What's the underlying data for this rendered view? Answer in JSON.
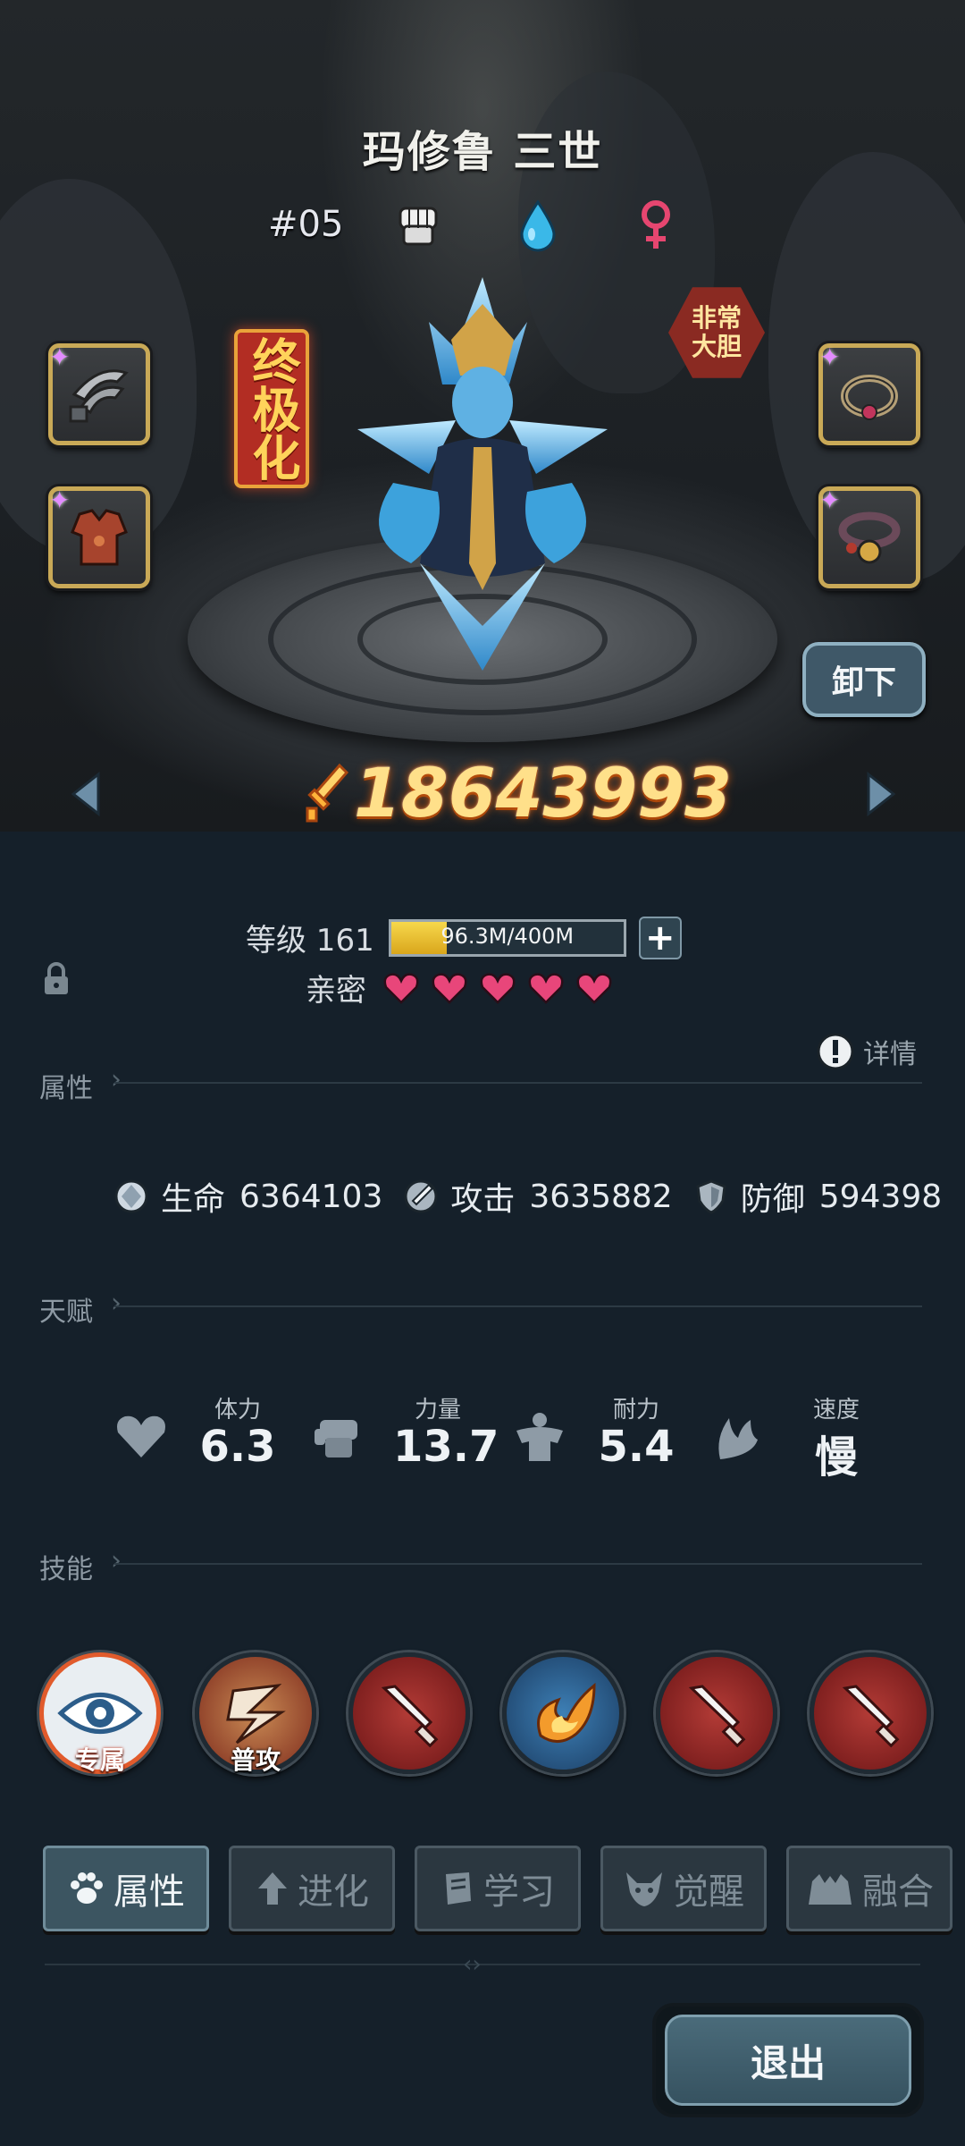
{
  "hero": {
    "name": "玛修鲁 三世",
    "number": "#05",
    "ultimate_label": "终极化",
    "trait_label": "非常大胆",
    "power": "18643993"
  },
  "equipment": {
    "unequip_label": "卸下",
    "slots": [
      {
        "icon": "claw-weapon-icon"
      },
      {
        "icon": "armor-vest-icon"
      },
      {
        "icon": "ring-icon"
      },
      {
        "icon": "bell-collar-icon"
      }
    ]
  },
  "level": {
    "label": "等级 161",
    "exp_text": "96.3M/400M",
    "exp_progress": 0.24
  },
  "intimacy": {
    "label": "亲密",
    "hearts": 5
  },
  "sections": {
    "attributes": "属性",
    "talent": "天赋",
    "skills": "技能",
    "detail": "详情"
  },
  "stats": [
    {
      "name": "生命",
      "value": "6364103",
      "icon": "health-orb-icon"
    },
    {
      "name": "攻击",
      "value": "3635882",
      "icon": "attack-sword-icon"
    },
    {
      "name": "防御",
      "value": "594398",
      "icon": "defense-shield-icon"
    }
  ],
  "talents": [
    {
      "label": "体力",
      "value": "6.3",
      "icon": "heart-icon"
    },
    {
      "label": "力量",
      "value": "13.7",
      "icon": "fist-icon"
    },
    {
      "label": "耐力",
      "value": "5.4",
      "icon": "torso-icon"
    },
    {
      "label": "速度",
      "value": "慢",
      "icon": "wing-icon"
    }
  ],
  "skills": [
    {
      "tag": "专属",
      "icon": "eye-icon"
    },
    {
      "tag": "普攻",
      "icon": "slash-claw-icon"
    },
    {
      "tag": "",
      "icon": "sword-icon"
    },
    {
      "tag": "",
      "icon": "fireball-icon"
    },
    {
      "tag": "",
      "icon": "sword-icon"
    },
    {
      "tag": "",
      "icon": "sword-icon"
    }
  ],
  "tabs": [
    {
      "label": "属性",
      "icon": "paw-icon",
      "active": true
    },
    {
      "label": "进化",
      "icon": "evolve-arrow-icon",
      "active": false
    },
    {
      "label": "学习",
      "icon": "book-icon",
      "active": false
    },
    {
      "label": "觉醒",
      "icon": "demon-head-icon",
      "active": false
    },
    {
      "label": "融合",
      "icon": "fusion-icon",
      "active": false
    }
  ],
  "exit_label": "退出",
  "colors": {
    "background": "#15202a",
    "gold": "#ffe08a",
    "heart": "#e8467a",
    "exp_fill": "#f0c93a"
  }
}
